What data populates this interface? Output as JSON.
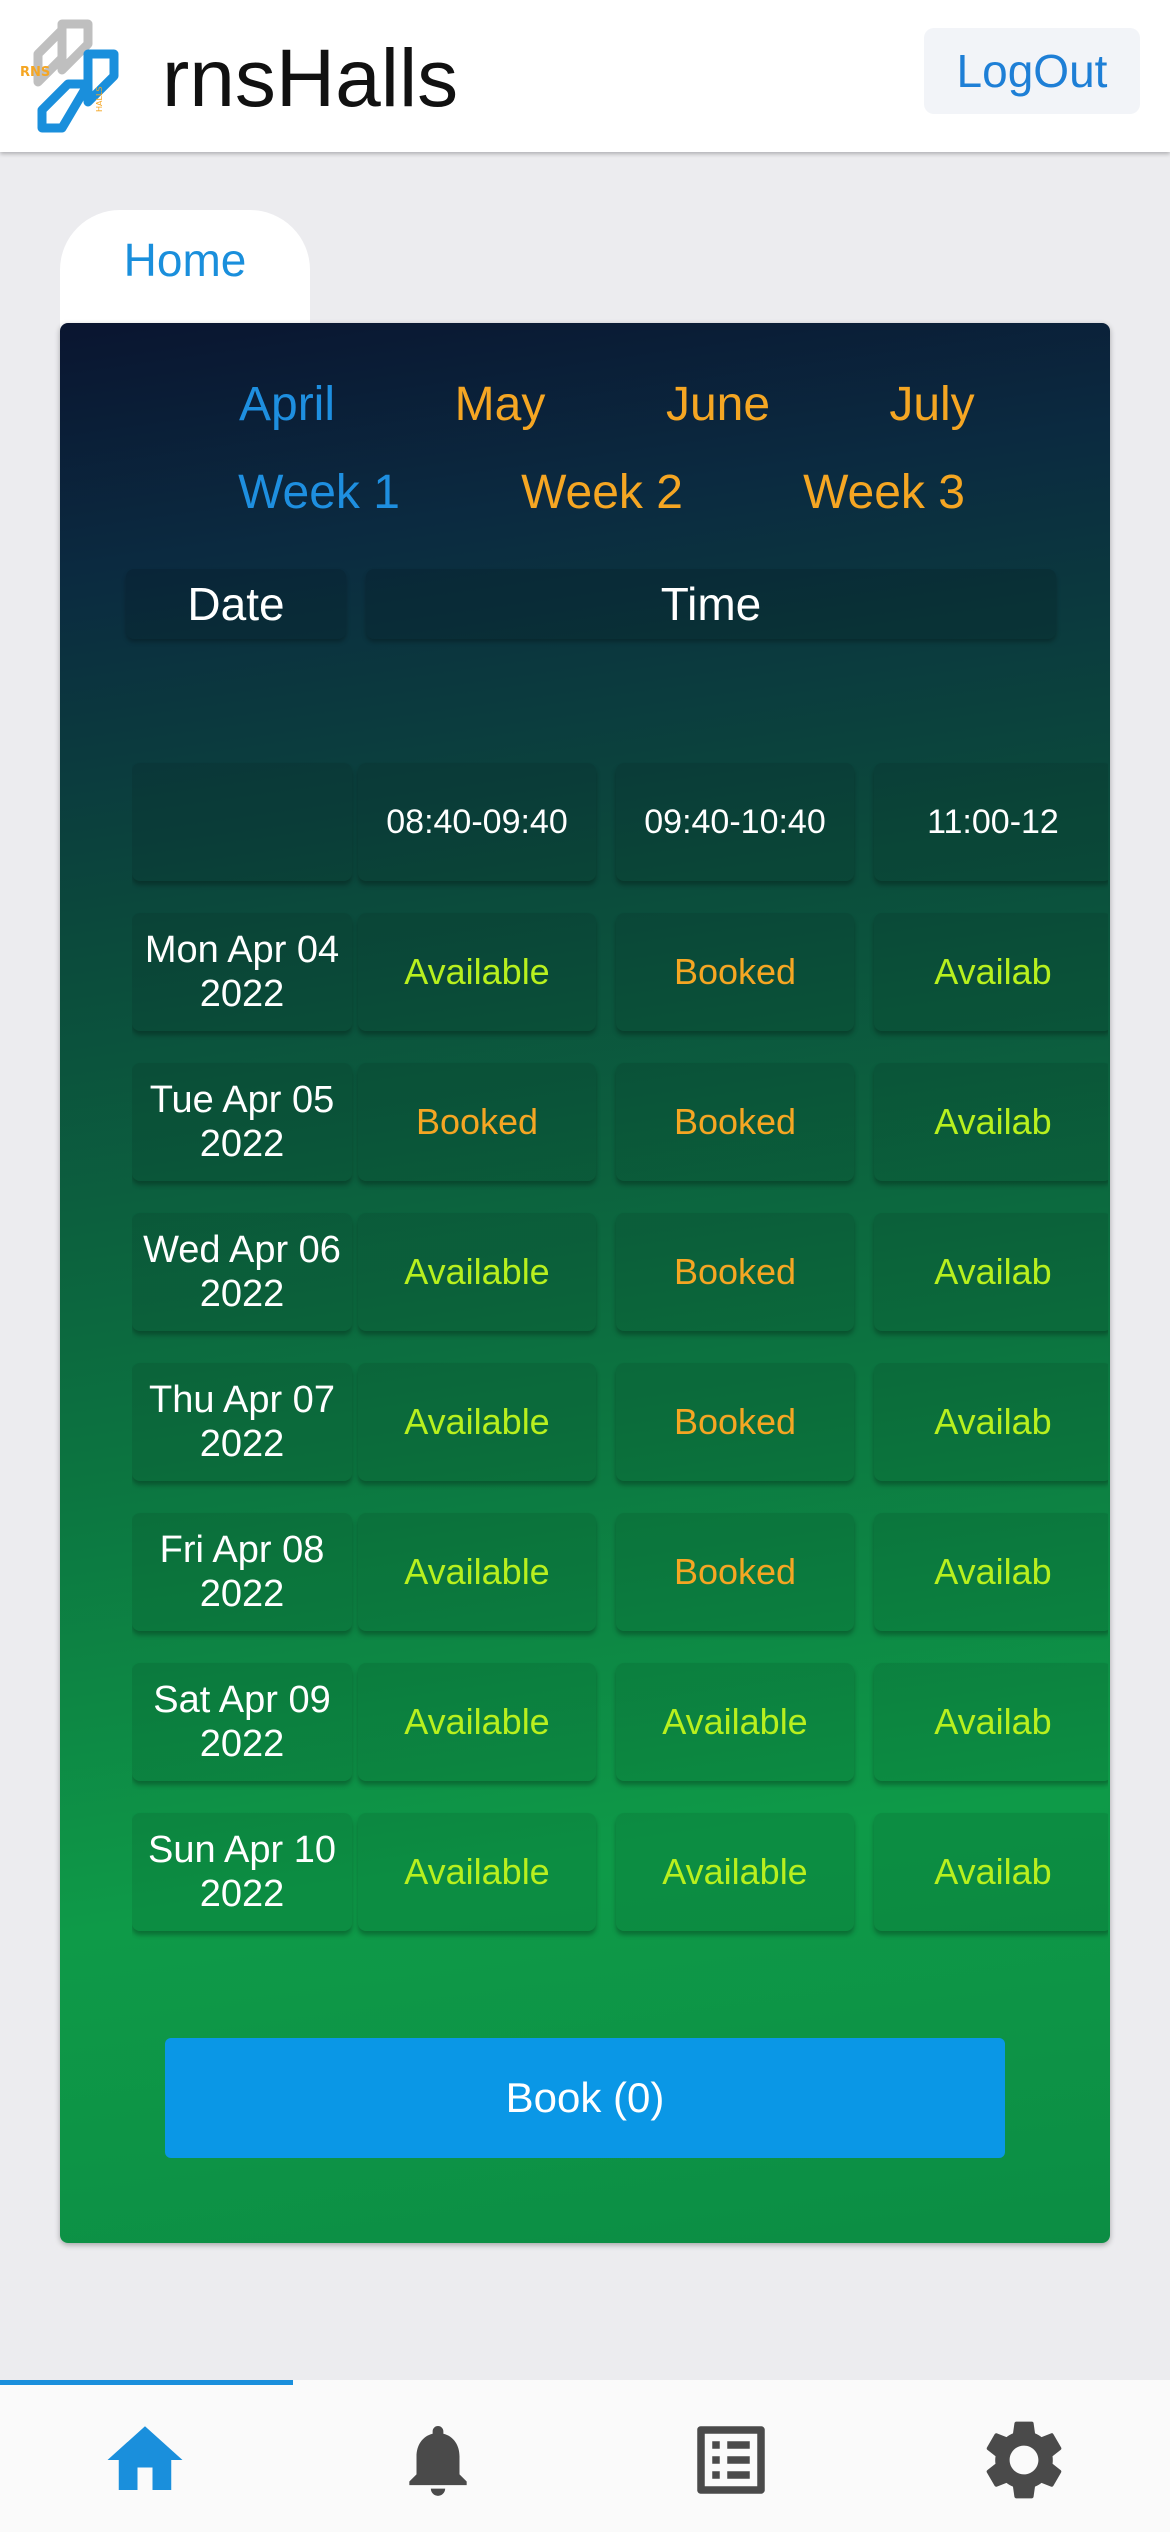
{
  "header": {
    "title": "rnsHalls",
    "logout_label": "LogOut",
    "logo_letters_top": "RNS",
    "logo_letters_side": "HALLS"
  },
  "tab": {
    "label": "Home"
  },
  "months": [
    {
      "label": "April",
      "selected": true
    },
    {
      "label": "May",
      "selected": false
    },
    {
      "label": "June",
      "selected": false
    },
    {
      "label": "July",
      "selected": false
    }
  ],
  "weeks": [
    {
      "label": "Week 1",
      "selected": true
    },
    {
      "label": "Week 2",
      "selected": false
    },
    {
      "label": "Week 3",
      "selected": false
    }
  ],
  "table": {
    "date_header": "Date",
    "time_header": "Time",
    "time_slots": [
      "08:40-09:40",
      "09:40-10:40",
      "11:00-12"
    ],
    "rows": [
      {
        "date": "Mon Apr 04 2022",
        "slots": [
          "Available",
          "Booked",
          "Availab"
        ]
      },
      {
        "date": "Tue Apr 05 2022",
        "slots": [
          "Booked",
          "Booked",
          "Availab"
        ]
      },
      {
        "date": "Wed Apr 06 2022",
        "slots": [
          "Available",
          "Booked",
          "Availab"
        ]
      },
      {
        "date": "Thu Apr 07 2022",
        "slots": [
          "Available",
          "Booked",
          "Availab"
        ]
      },
      {
        "date": "Fri Apr 08 2022",
        "slots": [
          "Available",
          "Booked",
          "Availab"
        ]
      },
      {
        "date": "Sat Apr 09 2022",
        "slots": [
          "Available",
          "Available",
          "Availab"
        ]
      },
      {
        "date": "Sun Apr 10 2022",
        "slots": [
          "Available",
          "Available",
          "Availab"
        ]
      }
    ]
  },
  "book_button": {
    "label": "Book (0)"
  },
  "bottom_nav": {
    "items": [
      {
        "icon": "home-icon",
        "active": true
      },
      {
        "icon": "bell-icon",
        "active": false
      },
      {
        "icon": "list-icon",
        "active": false
      },
      {
        "icon": "gear-icon",
        "active": false
      }
    ]
  },
  "colors": {
    "accent_blue": "#1a8fdc",
    "selected_text": "#1e8fe0",
    "unselected_text": "#f5a623",
    "available": "#b8f01e",
    "booked": "#f5a623",
    "book_button": "#0a97e6",
    "nav_active": "#1a8fdc",
    "nav_inactive": "#4a4a4a"
  }
}
